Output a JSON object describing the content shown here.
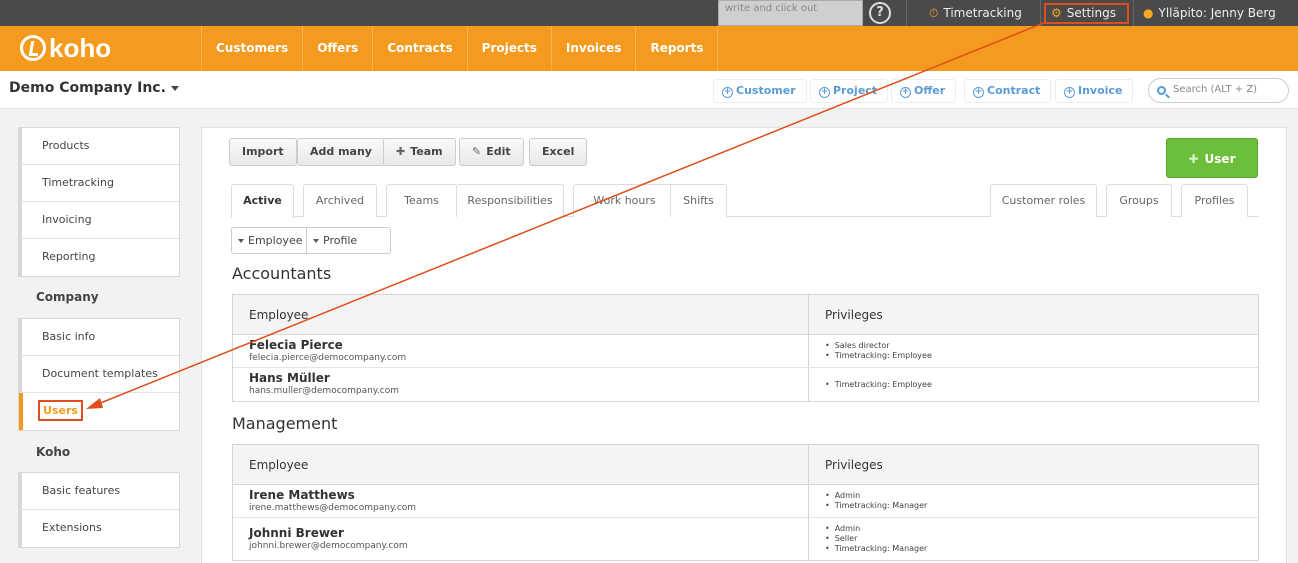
{
  "topbar": {
    "note": "write and click out",
    "help": "?",
    "timetracking": "Timetracking",
    "settings": "Settings",
    "user": "Ylläpito: Jenny Berg"
  },
  "brand": {
    "name": "koho",
    "color": "#f39a1f",
    "annotation_color": "#e04e1c"
  },
  "nav": [
    "Customers",
    "Offers",
    "Contracts",
    "Projects",
    "Invoices",
    "Reports"
  ],
  "subheader": {
    "company": "Demo Company Inc.",
    "quick_add": [
      "Customer",
      "Project",
      "Offer",
      "Contract",
      "Invoice"
    ],
    "search_placeholder": "Search (ALT + Z)"
  },
  "sidebar": {
    "group1": [
      "Products",
      "Timetracking",
      "Invoicing",
      "Reporting"
    ],
    "company_heading": "Company",
    "group2": [
      "Basic info",
      "Document templates",
      "Users"
    ],
    "koho_heading": "Koho",
    "group3": [
      "Basic features",
      "Extensions"
    ],
    "active": "Users"
  },
  "toolbar": {
    "import": "Import",
    "add_many": "Add many",
    "team": "Team",
    "edit": "Edit",
    "excel": "Excel",
    "user": "User"
  },
  "tabs": {
    "left": [
      "Active",
      "Archived",
      "Teams",
      "Responsibilities",
      "Work hours",
      "Shifts"
    ],
    "right": [
      "Customer roles",
      "Groups",
      "Profiles"
    ],
    "active": "Active"
  },
  "filters": {
    "employee": "Employee",
    "profile": "Profile"
  },
  "sections": [
    {
      "title": "Accountants",
      "headers": [
        "Employee",
        "Privileges"
      ],
      "rows": [
        {
          "name": "Felecia Pierce",
          "email": "felecia.pierce@democompany.com",
          "privileges": [
            "Sales director",
            "Timetracking: Employee"
          ]
        },
        {
          "name": "Hans Müller",
          "email": "hans.muller@democompany.com",
          "privileges": [
            "Timetracking: Employee"
          ]
        }
      ]
    },
    {
      "title": "Management",
      "headers": [
        "Employee",
        "Privileges"
      ],
      "rows": [
        {
          "name": "Irene Matthews",
          "email": "irene.matthews@democompany.com",
          "privileges": [
            "Admin",
            "Timetracking: Manager"
          ]
        },
        {
          "name": "Johnni Brewer",
          "email": "johnni.brewer@democompany.com",
          "privileges": [
            "Admin",
            "Seller",
            "Timetracking: Manager"
          ]
        }
      ]
    }
  ]
}
